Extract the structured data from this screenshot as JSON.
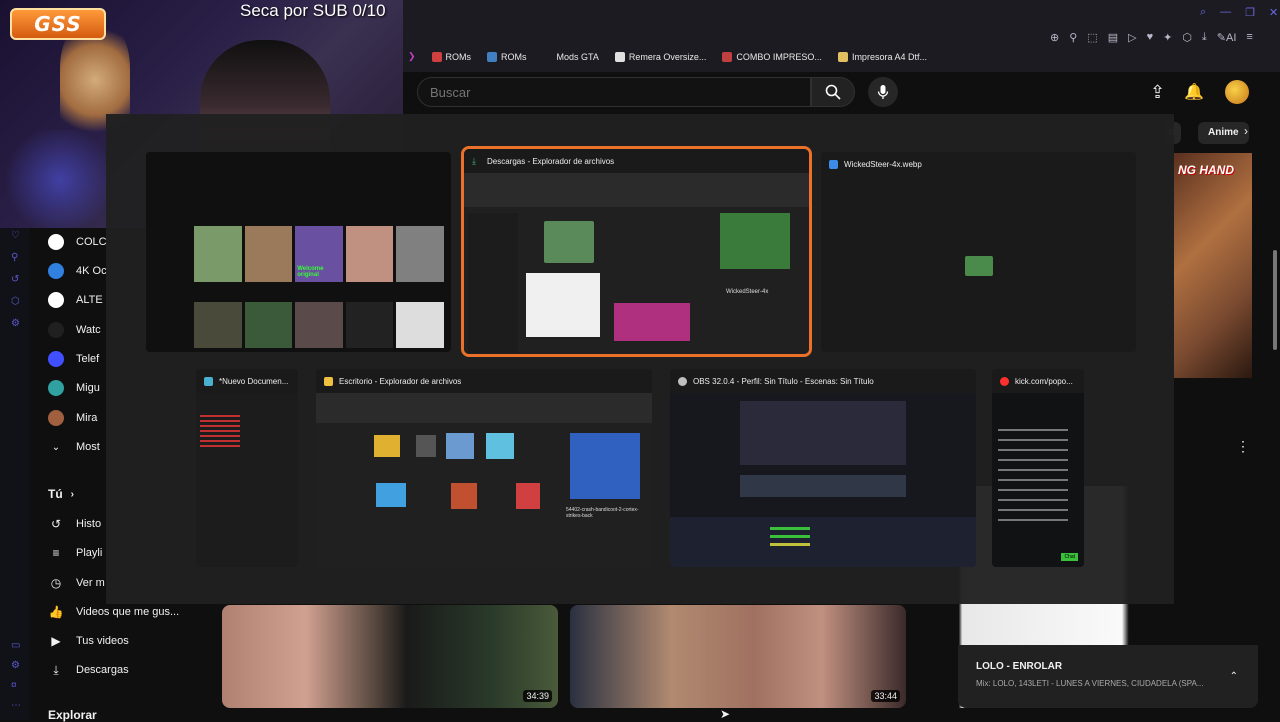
{
  "stream_overlay": {
    "logo_text": "GSS",
    "sub_goal": "Seca por SUB 0/10"
  },
  "bookmarks": [
    {
      "label": "ROMs",
      "color": "#d04040"
    },
    {
      "label": "ROMs",
      "color": "#4080c0"
    },
    {
      "label": "Mods GTA",
      "color": "#1c1b22"
    },
    {
      "label": "Remera Oversize...",
      "color": "#e0e0e0"
    },
    {
      "label": "COMBO IMPRESO...",
      "color": "#c04040"
    },
    {
      "label": "Impresora A4 Dtf...",
      "color": "#e0c060"
    }
  ],
  "header": {
    "search_placeholder": "Buscar"
  },
  "sidebar": {
    "subscriptions": [
      {
        "label": "COLC",
        "color": "#ffffff"
      },
      {
        "label": "4K Oc",
        "color": "#3080e0"
      },
      {
        "label": "ALTE",
        "color": "#ffffff"
      },
      {
        "label": "Watc",
        "color": "#202020"
      },
      {
        "label": "Telef",
        "color": "#4050ff"
      },
      {
        "label": "Migu",
        "color": "#30a0a0"
      },
      {
        "label": "Mira",
        "color": "#a06040"
      }
    ],
    "show_more": "Most",
    "you_section": "Tú",
    "you_items": [
      {
        "label": "Histo",
        "icon": "history-icon",
        "glyph": "↺"
      },
      {
        "label": "Playli",
        "icon": "playlist-icon",
        "glyph": "≡"
      },
      {
        "label": "Ver m",
        "icon": "clock-icon",
        "glyph": "◷"
      },
      {
        "label": "Videos que me gus...",
        "icon": "like-icon",
        "glyph": "👍"
      },
      {
        "label": "Tus videos",
        "icon": "your-videos-icon",
        "glyph": "▶"
      },
      {
        "label": "Descargas",
        "icon": "download-icon",
        "glyph": "⤓"
      }
    ],
    "explore": "Explorar"
  },
  "switcher": {
    "windows": [
      {
        "id": "win-explorer-downloads",
        "title": "Descargas - Explorador de archivos",
        "icon_color": "#3cb371",
        "selected": true
      },
      {
        "id": "win-webp",
        "title": "WickedSteer-4x.webp",
        "icon_color": "#3c8ce7",
        "selected": false
      },
      {
        "id": "win-notepad",
        "title": "*Nuevo Documen...",
        "icon_color": "#4ab0d0",
        "selected": false
      },
      {
        "id": "win-explorer-desktop",
        "title": "Escritorio - Explorador de archivos",
        "icon_color": "#f0c040",
        "selected": false
      },
      {
        "id": "win-obs",
        "title": "OBS 32.0.4 - Perfil: Sin Título - Escenas: Sin Título",
        "icon_color": "#c0c0c0",
        "selected": false
      },
      {
        "id": "win-kick",
        "title": "kick.com/popo...",
        "icon_color": "#ff3030",
        "selected": false
      }
    ],
    "thumb_texts": {
      "video_thumb_caption": "Welcome original",
      "explorer_file": "WickedSteer-4x",
      "desktop_file": "54402-crash-bandicoot-2-cortex-strikes-back",
      "kick_chat_button": "Chat"
    }
  },
  "chips": {
    "partial": "n",
    "anime": "Anime"
  },
  "right_thumb_text": "NG HAND",
  "videos": [
    {
      "duration": "34:39"
    },
    {
      "duration": "33:44"
    }
  ],
  "mix": {
    "title": "LOLO - ENROLAR",
    "subtitle": "Mix: LOLO, 143LETI - LUNES A VIERNES, CIUDADELA (SPA..."
  }
}
